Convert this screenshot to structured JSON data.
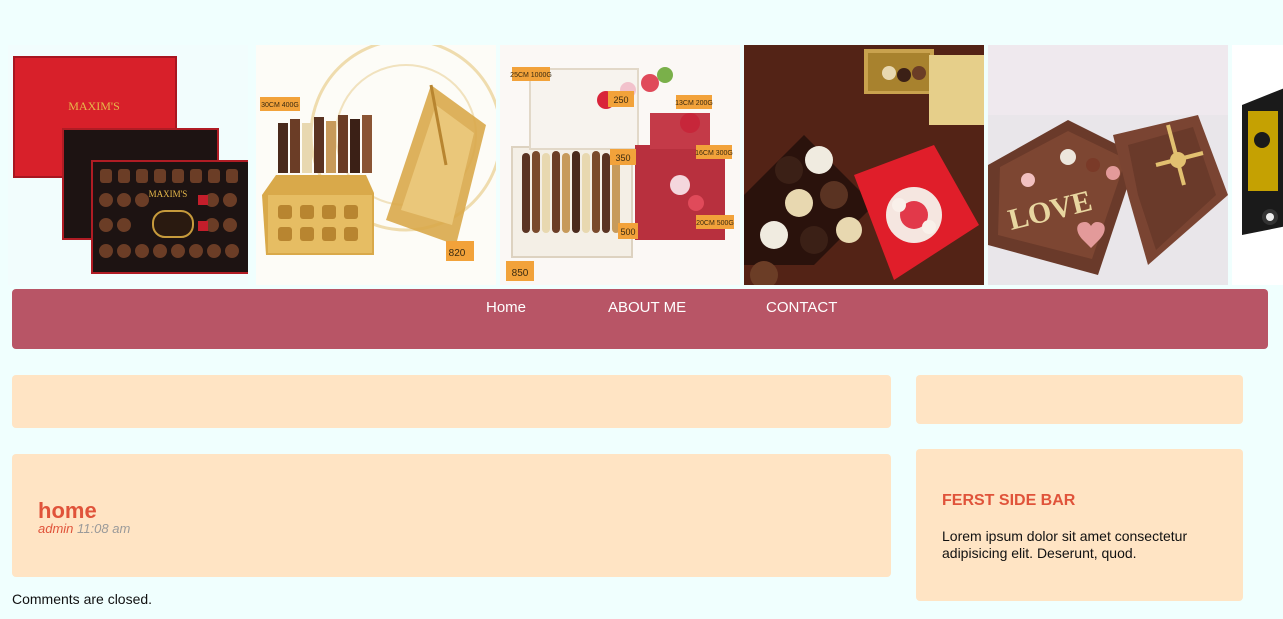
{
  "gallery": {
    "images": [
      {
        "name": "chocolate-box-red-image"
      },
      {
        "name": "chocolate-lantern-image",
        "labels": [
          "30CM 400G",
          "820"
        ]
      },
      {
        "name": "chocolate-tray-flowers-image",
        "labels": [
          "25CM 1000G",
          "13CM 200G",
          "16CM 300G",
          "20CM 500G",
          "850",
          "500",
          "350",
          "250"
        ]
      },
      {
        "name": "truffle-box-image"
      },
      {
        "name": "love-box-image",
        "labels": [
          "LOVE"
        ]
      },
      {
        "name": "partial-chocolate-image"
      }
    ]
  },
  "nav": {
    "items": [
      "Home",
      "ABOUT ME",
      "CONTACT"
    ]
  },
  "post": {
    "title": "home",
    "author": "admin",
    "time": "11:08 am",
    "comments_note": "Comments are closed."
  },
  "sidebar": {
    "title": "FERST SIDE BAR",
    "text": "Lorem ipsum dolor sit amet consectetur adipisicing elit. Deserunt, quod."
  },
  "colors": {
    "background": "#f0fffe",
    "nav": "#b85566",
    "panel": "#ffe4c4",
    "accent": "#e0533a"
  }
}
